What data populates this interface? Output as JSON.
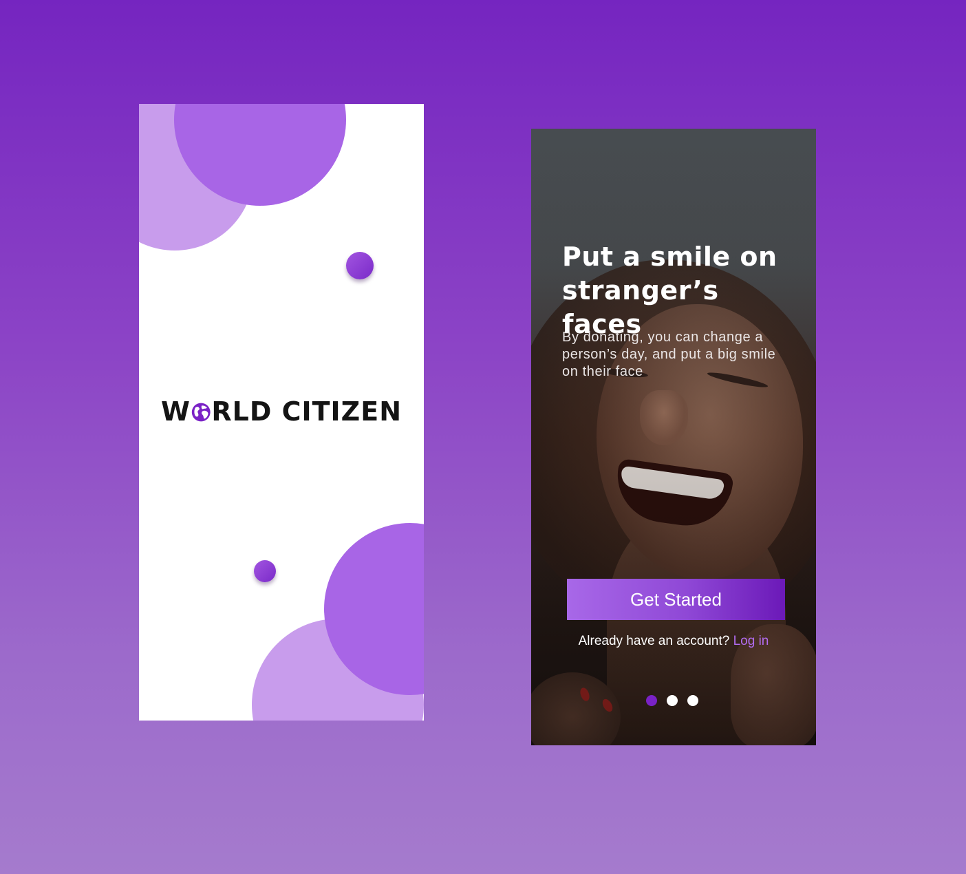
{
  "splash": {
    "logo": {
      "prefix": "W",
      "suffix": "RLD CITIZEN",
      "globe_icon": "globe-icon"
    }
  },
  "onboarding": {
    "title": "Put a smile on stranger’s faces",
    "subtitle": "By donating, you can change a person’s day, and put a big smile on their face",
    "get_started_label": "Get Started",
    "login_prompt": "Already have an account? ",
    "login_link": "Log in",
    "pager": {
      "count": 3,
      "active_index": 0
    }
  },
  "colors": {
    "accent": "#7a22c6",
    "circle_dark": "#a865e6",
    "circle_light": "#c89cec",
    "link": "#b26cf0"
  }
}
